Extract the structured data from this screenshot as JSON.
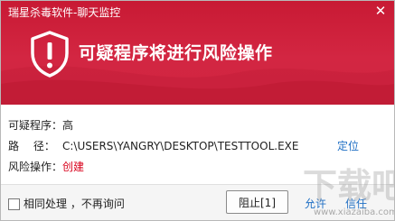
{
  "window": {
    "title": "瑞星杀毒软件-聊天监控",
    "close_symbol": "✕"
  },
  "header": {
    "warning": "可疑程序将进行风险操作",
    "icon": "shield-exclamation-icon"
  },
  "details": {
    "program": {
      "label": "可疑程序：",
      "value": "高"
    },
    "path": {
      "label": "路　 径：",
      "value": "C:\\USERS\\YANGRY\\DESKTOP\\TESTTOOL.EXE"
    },
    "operation": {
      "label": "风险操作：",
      "value": "创建"
    },
    "locate_label": "定位"
  },
  "footer": {
    "same_handling_label": "相同处理 ，不再询问",
    "same_handling_checked": false,
    "block_label": "阻止[1]",
    "allow_label": "允许",
    "trust_label": "信任"
  },
  "watermark": {
    "text": "下载吧",
    "url": "www.xiazaiba.com"
  },
  "colors": {
    "header": "#d32642",
    "danger_text": "#d9001b",
    "link": "#1f6fc4"
  }
}
